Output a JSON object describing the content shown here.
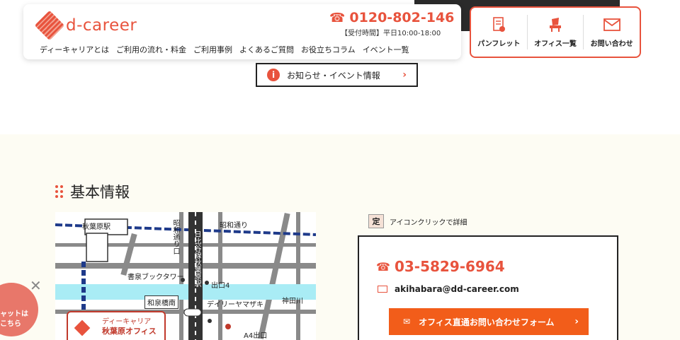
{
  "header": {
    "logo_text": "d-career",
    "tel_number": "0120-802-146",
    "tel_hours": "【受付時間】平日10:00-18:00",
    "nav": [
      "ディーキャリアとは",
      "ご利用の流れ・料金",
      "ご利用事例",
      "よくあるご質問",
      "お役立ちコラム",
      "イベント一覧"
    ]
  },
  "quick_links": [
    {
      "label": "パンフレット",
      "icon": "pamphlet-icon"
    },
    {
      "label": "オフィス一覧",
      "icon": "office-chair-icon"
    },
    {
      "label": "お問い合わせ",
      "icon": "mail-icon"
    }
  ],
  "news_button": {
    "label": "お知らせ・イベント情報"
  },
  "section": {
    "title": "基本情報"
  },
  "map": {
    "station": "秋葉原駅",
    "street_showa": "昭和通り",
    "vertical_showa_exit": "昭和通り口",
    "vertical_line": "日比谷線秋葉原駅",
    "bookstore": "書泉ブックタワー",
    "exit4": "出口4",
    "bridge": "和泉橋南",
    "river": "神田川",
    "daily": "デイリーヤマザキ",
    "exit_a4": "A4出口",
    "office_line1": "ディーキャリア",
    "office_line2": "秋葉原オフィス"
  },
  "info": {
    "teiki_badge": "定",
    "teiki_text": "アイコンクリックで詳細",
    "phone": "03-5829-6964",
    "email": "akihabara@dd-career.com",
    "form_button": "オフィス直通お問い合わせフォーム"
  },
  "chat": {
    "line1": "ャットは",
    "line2": "こちら"
  },
  "colors": {
    "accent": "#e8533d",
    "button": "#f25d1a",
    "section_bg": "#fdfcf3"
  }
}
